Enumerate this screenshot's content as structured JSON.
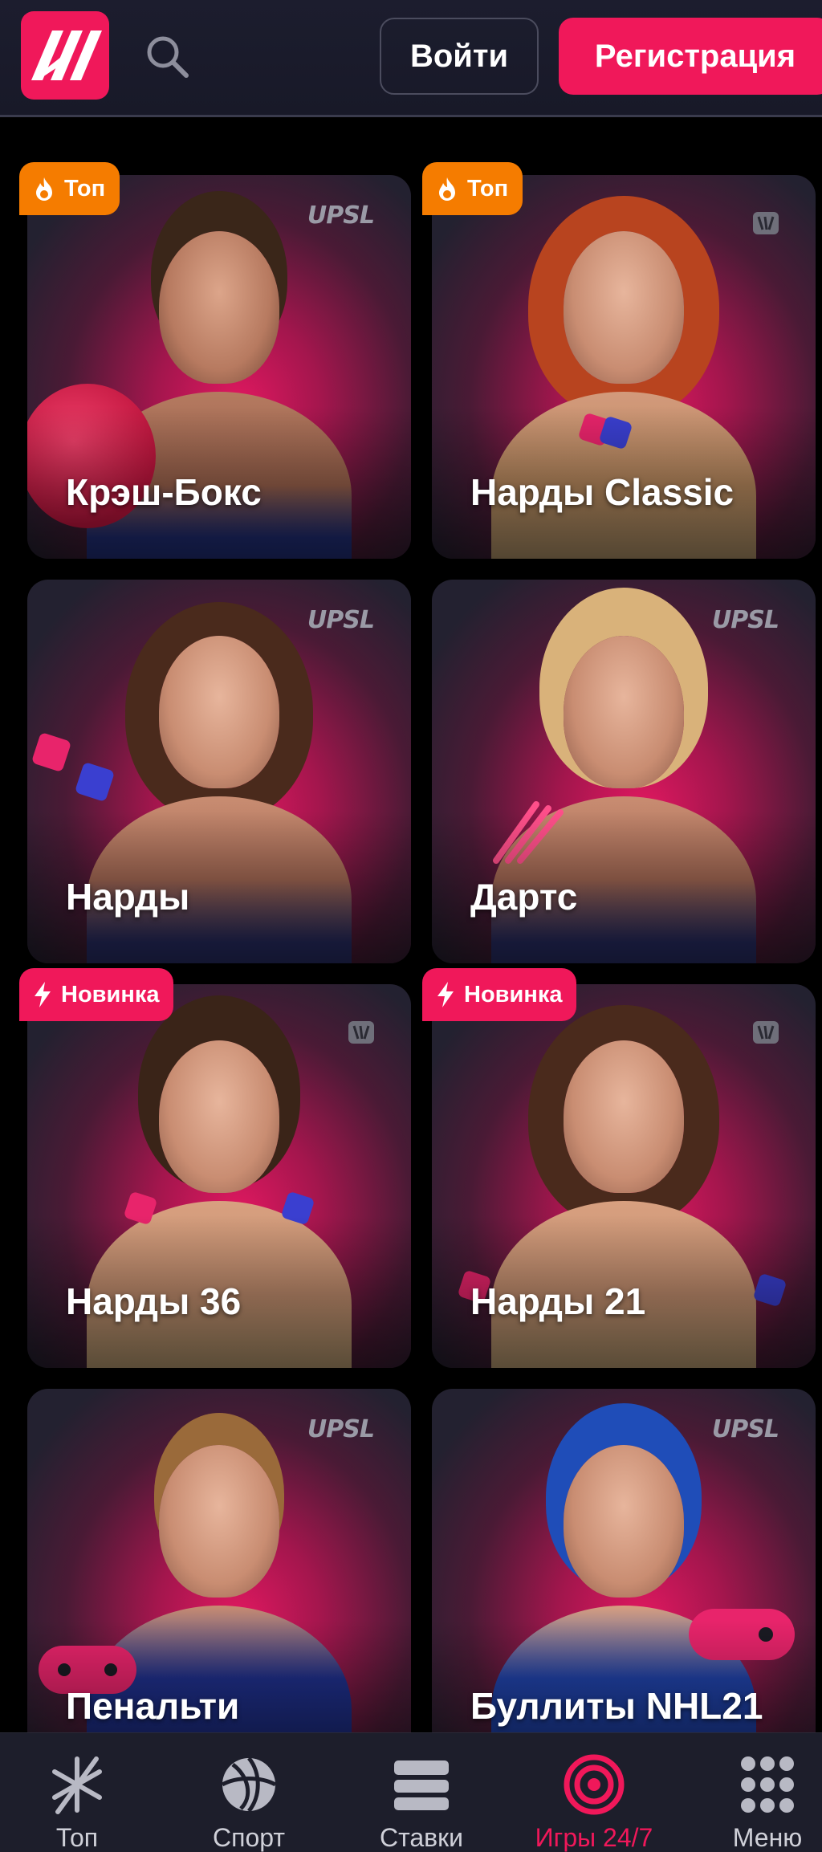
{
  "header": {
    "login_label": "Войти",
    "register_label": "Регистрация"
  },
  "games": [
    {
      "title": "Крэш-Бокс",
      "badge": "Топ",
      "badge_type": "top",
      "provider": "UPSL"
    },
    {
      "title": "Нарды Classic",
      "badge": "Топ",
      "badge_type": "top",
      "provider": ""
    },
    {
      "title": "Нарды",
      "badge": "",
      "badge_type": "",
      "provider": "UPSL"
    },
    {
      "title": "Дартс",
      "badge": "",
      "badge_type": "",
      "provider": "UPSL"
    },
    {
      "title": "Нарды 36",
      "badge": "Новинка",
      "badge_type": "new",
      "provider": ""
    },
    {
      "title": "Нарды 21",
      "badge": "Новинка",
      "badge_type": "new",
      "provider": ""
    },
    {
      "title": "Пенальти",
      "badge": "",
      "badge_type": "",
      "provider": "UPSL"
    },
    {
      "title": "Буллиты NHL21",
      "badge": "",
      "badge_type": "",
      "provider": "UPSL"
    }
  ],
  "bottom_nav": {
    "items": [
      {
        "label": "Топ",
        "icon": "star-burst-icon"
      },
      {
        "label": "Спорт",
        "icon": "volleyball-icon"
      },
      {
        "label": "Ставки",
        "icon": "stack-icon"
      },
      {
        "label": "Игры 24/7",
        "icon": "target-icon"
      },
      {
        "label": "Меню",
        "icon": "grid-dots-icon"
      }
    ],
    "active_index": 3
  },
  "colors": {
    "accent": "#f0185a",
    "badge_top": "#f57c00",
    "header_bg": "#1c1d2e",
    "nav_bg": "#1d1e2b"
  }
}
